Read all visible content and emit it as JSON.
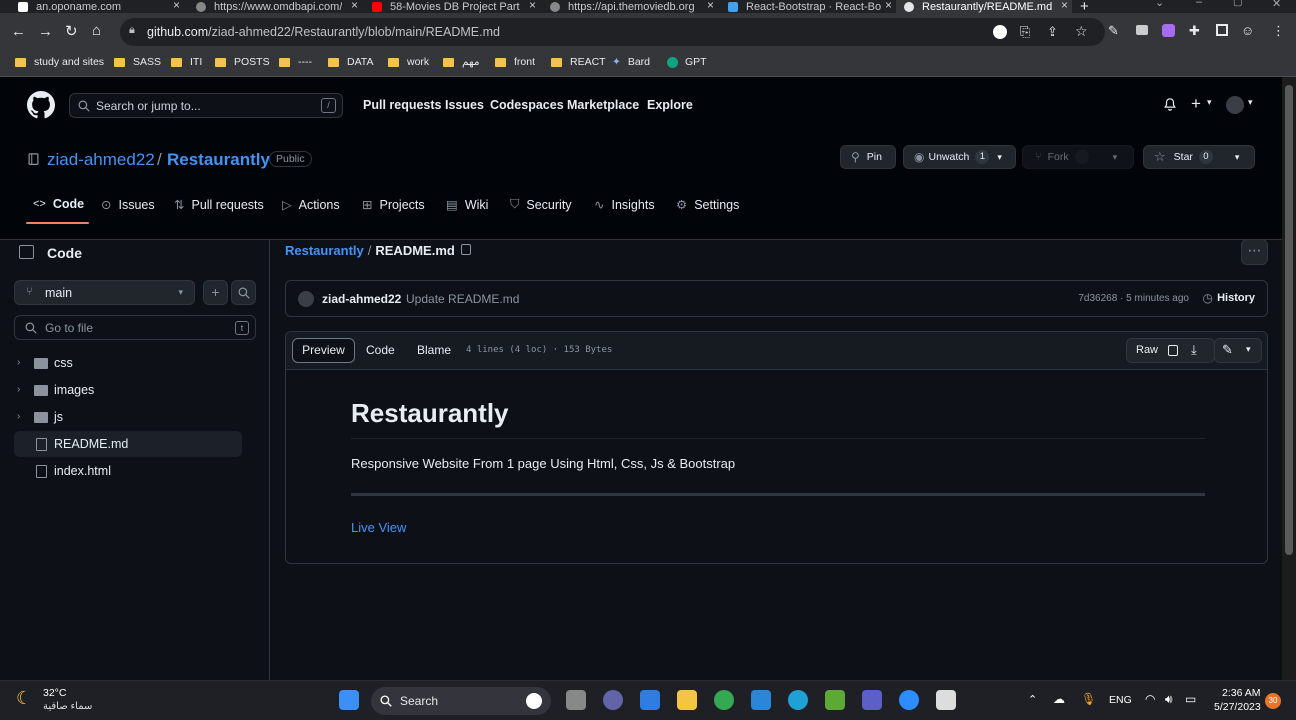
{
  "browser": {
    "tabs": [
      {
        "title": "an.oponame.com",
        "active": false
      },
      {
        "title": "https://www.omdbapi.com/",
        "active": false
      },
      {
        "title": "58-Movies DB Project Part",
        "active": false
      },
      {
        "title": "https://api.themoviedb.org",
        "active": false
      },
      {
        "title": "React-Bootstrap · React-Bo",
        "active": false
      },
      {
        "title": "Restaurantly/README.md",
        "active": true
      }
    ],
    "new_tab": "+",
    "url_host": "github.com",
    "url_path": "/ziad-ahmed22/Restaurantly/blob/main/README.md",
    "bookmarks": [
      "study and sites",
      "SASS",
      "ITI",
      "POSTS",
      "----",
      "DATA",
      "work",
      "مهم",
      "front",
      "REACT",
      "Bard",
      "GPT"
    ]
  },
  "github": {
    "search_placeholder": "Search or jump to...",
    "search_key": "/",
    "nav": [
      "Pull requests",
      "Issues",
      "Codespaces",
      "Marketplace",
      "Explore"
    ],
    "plus": "+"
  },
  "repo": {
    "owner": "ziad-ahmed22",
    "separator": "/",
    "name": "Restaurantly",
    "visibility": "Public",
    "pin_label": "Pin",
    "unwatch_label": "Unwatch",
    "unwatch_count": "1",
    "fork_label": "Fork",
    "fork_count": "",
    "star_label": "Star",
    "star_count": "0",
    "tabs": [
      "Code",
      "Issues",
      "Pull requests",
      "Actions",
      "Projects",
      "Wiki",
      "Security",
      "Insights",
      "Settings"
    ]
  },
  "sidebar": {
    "title": "Code",
    "branch": "main",
    "goto_placeholder": "Go to file",
    "goto_key": "t",
    "tree": [
      {
        "name": "css",
        "type": "dir"
      },
      {
        "name": "images",
        "type": "dir"
      },
      {
        "name": "js",
        "type": "dir"
      },
      {
        "name": "README.md",
        "type": "file"
      },
      {
        "name": "index.html",
        "type": "file"
      }
    ]
  },
  "file": {
    "crumb_repo": "Restaurantly",
    "crumb_sep": "/",
    "crumb_file": "README.md",
    "commit_author": "ziad-ahmed22",
    "commit_message": "Update README.md",
    "commit_meta": "7d36268 · 5 minutes ago",
    "history_label": "History",
    "view_preview": "Preview",
    "view_code": "Code",
    "view_blame": "Blame",
    "file_info": "4 lines (4 loc) · 153 Bytes",
    "raw_label": "Raw"
  },
  "readme": {
    "title": "Restaurantly",
    "description": "Responsive Website From 1 page Using Html, Css, Js & Bootstrap",
    "link": "Live View"
  },
  "taskbar": {
    "temperature": "32°C",
    "weather": "سماء صافية",
    "search_label": "Search",
    "language": "ENG",
    "time": "2:36 AM",
    "date": "5/27/2023",
    "notifications": "30"
  },
  "colors": {
    "accent_link": "#4493f8",
    "tab_underline": "#f78166",
    "bg": "#0d1117",
    "header_bg": "#010409",
    "border": "#30363d"
  }
}
